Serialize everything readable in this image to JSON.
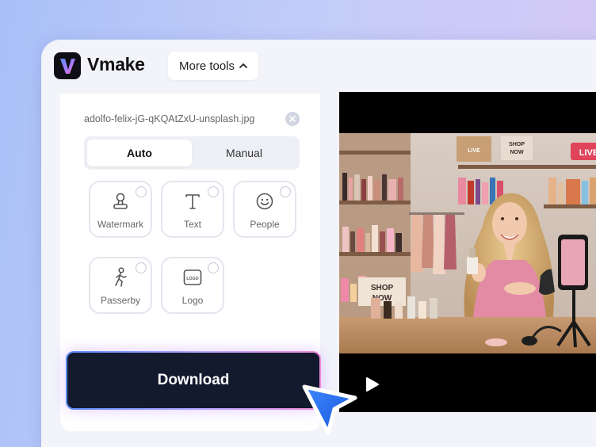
{
  "header": {
    "brand": "Vmake",
    "more_tools_label": "More tools"
  },
  "file": {
    "name": "adolfo-felix-jG-qKQAtZxU-unsplash.jpg"
  },
  "mode_tabs": [
    {
      "label": "Auto",
      "active": true
    },
    {
      "label": "Manual",
      "active": false
    }
  ],
  "tools": [
    {
      "label": "Watermark",
      "icon": "watermark-icon"
    },
    {
      "label": "Text",
      "icon": "text-icon"
    },
    {
      "label": "People",
      "icon": "people-icon"
    },
    {
      "label": "Passerby",
      "icon": "passerby-icon"
    },
    {
      "label": "Logo",
      "icon": "logo-icon"
    }
  ],
  "download_label": "Download",
  "preview": {
    "sign_shop_now": "SHOP NOW",
    "sign_live": "LIVE",
    "logo_glyph": "LOGO"
  },
  "colors": {
    "accent": "#141a2e",
    "cursor": "#1f6df0",
    "live": "#e0445a"
  }
}
